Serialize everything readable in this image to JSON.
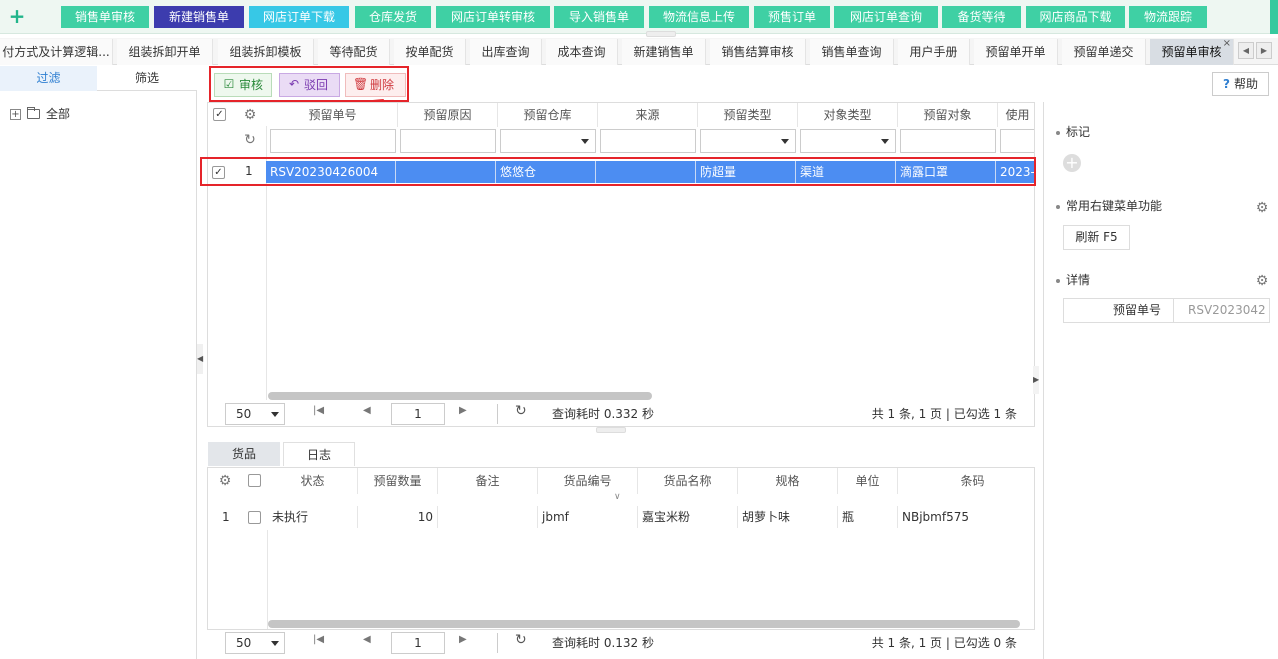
{
  "quickbar": {
    "add_icon": "plus-icon",
    "buttons": [
      "销售单审核",
      "新建销售单",
      "网店订单下载",
      "仓库发货",
      "网店订单转审核",
      "导入销售单",
      "物流信息上传",
      "预售订单",
      "网店订单查询",
      "备货等待",
      "网店商品下载",
      "物流跟踪"
    ]
  },
  "tabs": [
    "付方式及计算逻辑...",
    "组装拆卸开单",
    "组装拆卸模板",
    "等待配货",
    "按单配货",
    "出库查询",
    "成本查询",
    "新建销售单",
    "销售结算审核",
    "销售单查询",
    "用户手册",
    "预留单开单",
    "预留单递交",
    "预留单审核"
  ],
  "tab_close": "×",
  "left": {
    "tab_filter": "过滤",
    "tab_screen": "筛选",
    "tree_expander": "+",
    "tree_root": "全部"
  },
  "toolbar": {
    "approve": "审核",
    "reject": "驳回",
    "delete": "删除"
  },
  "help": {
    "icon": "?",
    "label": "帮助"
  },
  "grid": {
    "columns": [
      "预留单号",
      "预留原因",
      "预留仓库",
      "来源",
      "预留类型",
      "对象类型",
      "预留对象",
      "使用"
    ],
    "rows": [
      {
        "index": "1",
        "order_no": "RSV20230426004",
        "reason": "",
        "warehouse": "悠悠仓",
        "source": "",
        "type": "防超量",
        "object_type": "渠道",
        "object": "滴露口罩",
        "use": "2023-"
      }
    ]
  },
  "pager1": {
    "size": "50",
    "page": "1",
    "timing": "查询耗时 0.332 秒",
    "info": "共 1 条, 1 页 | 已勾选 1 条"
  },
  "bottom_tabs": {
    "goods": "货品",
    "log": "日志"
  },
  "subgrid": {
    "columns": [
      "状态",
      "预留数量",
      "备注",
      "货品编号",
      "货品名称",
      "规格",
      "单位",
      "条码"
    ],
    "rows": [
      {
        "index": "1",
        "status": "未执行",
        "qty": "10",
        "note": "",
        "code": "jbmf",
        "name": "嘉宝米粉",
        "spec": "胡萝卜味",
        "unit": "瓶",
        "barcode": "NBjbmf575"
      }
    ]
  },
  "pager2": {
    "size": "50",
    "page": "1",
    "timing": "查询耗时 0.132 秒",
    "info": "共 1 条, 1 页 | 已勾选 0 条"
  },
  "right": {
    "mark": "标记",
    "context_menu": "常用右键菜单功能",
    "refresh": "刷新 F5",
    "details": "详情",
    "detail_key": "预留单号",
    "detail_value": "RSV2023042"
  },
  "colors": {
    "accent": "#3fd0a4",
    "selected_row": "#4c8df2",
    "highlight": "#e5242a",
    "active_quick": "#3c3cae"
  }
}
